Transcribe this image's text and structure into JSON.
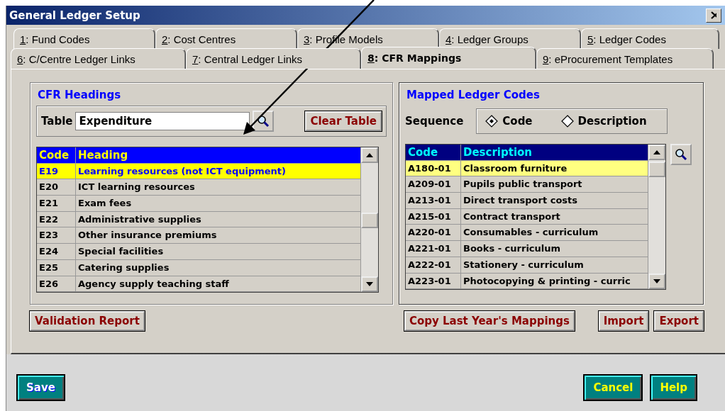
{
  "window": {
    "title": "General Ledger Setup"
  },
  "tabs": [
    [
      {
        "label": "1: Fund Codes",
        "selected": false
      },
      {
        "label": "2: Cost Centres",
        "selected": false
      },
      {
        "label": "3: Profile Models",
        "selected": false
      },
      {
        "label": "4: Ledger Groups",
        "selected": false
      },
      {
        "label": "5: Ledger Codes",
        "selected": false
      }
    ],
    [
      {
        "label": "6: C/Centre Ledger Links",
        "selected": false
      },
      {
        "label": "7: Central Ledger Links",
        "selected": false
      },
      {
        "label": "8: CFR Mappings",
        "selected": true
      },
      {
        "label": "9: eProcurement Templates",
        "selected": false
      }
    ]
  ],
  "cfr_headings": {
    "title": "CFR Headings",
    "table_label": "Table",
    "table_value": "Expenditure",
    "clear_button": "Clear Table",
    "columns": [
      "Code",
      "Heading"
    ],
    "rows": [
      {
        "code": "E19",
        "heading": "Learning resources (not ICT equipment)",
        "selected": true
      },
      {
        "code": "E20",
        "heading": "ICT learning resources",
        "selected": false
      },
      {
        "code": "E21",
        "heading": "Exam fees",
        "selected": false
      },
      {
        "code": "E22",
        "heading": "Administrative supplies",
        "selected": false
      },
      {
        "code": "E23",
        "heading": "Other insurance premiums",
        "selected": false
      },
      {
        "code": "E24",
        "heading": "Special facilities",
        "selected": false
      },
      {
        "code": "E25",
        "heading": "Catering supplies",
        "selected": false
      },
      {
        "code": "E26",
        "heading": "Agency supply teaching staff",
        "selected": false
      }
    ]
  },
  "mapped_ledger_codes": {
    "title": "Mapped Ledger Codes",
    "sequence_label": "Sequence",
    "sequence_options": [
      {
        "label": "Code",
        "selected": true
      },
      {
        "label": "Description",
        "selected": false
      }
    ],
    "columns": [
      "Code",
      "Description"
    ],
    "rows": [
      {
        "code": "A180-01",
        "description": "Classroom furniture",
        "selected": true
      },
      {
        "code": "A209-01",
        "description": "Pupils public transport",
        "selected": false
      },
      {
        "code": "A213-01",
        "description": "Direct transport costs",
        "selected": false
      },
      {
        "code": "A215-01",
        "description": "Contract transport",
        "selected": false
      },
      {
        "code": "A220-01",
        "description": "Consumables - curriculum",
        "selected": false
      },
      {
        "code": "A221-01",
        "description": "Books - curriculum",
        "selected": false
      },
      {
        "code": "A222-01",
        "description": "Stationery - curriculum",
        "selected": false
      },
      {
        "code": "A223-01",
        "description": "Photocopying & printing - curric",
        "selected": false
      }
    ]
  },
  "panel_buttons": [
    "Validation Report",
    "Copy Last Year's Mappings",
    "Import",
    "Export"
  ],
  "footer_buttons": [
    {
      "label": "Save",
      "kind": "default"
    },
    {
      "label": "Cancel",
      "kind": "accent"
    },
    {
      "label": "Help",
      "kind": "accent"
    }
  ]
}
